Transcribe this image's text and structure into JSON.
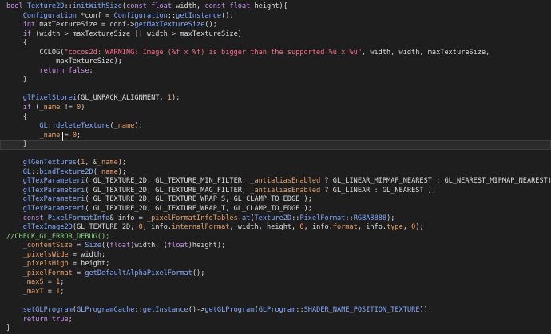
{
  "editor": {
    "lines": [
      {
        "tokens": [
          {
            "t": "bool ",
            "c": "kw"
          },
          {
            "t": "Texture2D",
            "c": "type"
          },
          {
            "t": "::",
            "c": "p"
          },
          {
            "t": "initWithSize",
            "c": "fn"
          },
          {
            "t": "(",
            "c": "p"
          },
          {
            "t": "const float ",
            "c": "kw"
          },
          {
            "t": "width, ",
            "c": "txt"
          },
          {
            "t": "const float ",
            "c": "kw"
          },
          {
            "t": "height){",
            "c": "txt"
          }
        ]
      },
      {
        "tokens": [
          {
            "t": "    ",
            "c": "txt"
          },
          {
            "t": "Configuration ",
            "c": "type"
          },
          {
            "t": "*conf = ",
            "c": "txt"
          },
          {
            "t": "Configuration",
            "c": "type"
          },
          {
            "t": "::",
            "c": "p"
          },
          {
            "t": "getInstance",
            "c": "fn"
          },
          {
            "t": "();",
            "c": "p"
          }
        ]
      },
      {
        "tokens": [
          {
            "t": "    ",
            "c": "txt"
          },
          {
            "t": "int ",
            "c": "kw"
          },
          {
            "t": "maxTextureSize = conf->",
            "c": "txt"
          },
          {
            "t": "getMaxTextureSize",
            "c": "fn"
          },
          {
            "t": "();",
            "c": "p"
          }
        ]
      },
      {
        "tokens": [
          {
            "t": "    ",
            "c": "txt"
          },
          {
            "t": "if ",
            "c": "kw"
          },
          {
            "t": "(width > maxTextureSize || width > maxTextureSize)",
            "c": "txt"
          }
        ]
      },
      {
        "tokens": [
          {
            "t": "    {",
            "c": "txt"
          }
        ]
      },
      {
        "tokens": [
          {
            "t": "        CCLOG(",
            "c": "txt"
          },
          {
            "t": "\"cocos2d: WARNING: Image (%f x %f) is bigger than the supported %u x %u\"",
            "c": "str"
          },
          {
            "t": ", width, width, maxTextureSize,",
            "c": "txt"
          }
        ]
      },
      {
        "tokens": [
          {
            "t": "            maxTextureSize);",
            "c": "txt"
          }
        ]
      },
      {
        "tokens": [
          {
            "t": "        ",
            "c": "txt"
          },
          {
            "t": "return false",
            "c": "kw"
          },
          {
            "t": ";",
            "c": "p"
          }
        ]
      },
      {
        "tokens": [
          {
            "t": "    }",
            "c": "txt"
          }
        ]
      },
      {
        "tokens": []
      },
      {
        "tokens": [
          {
            "t": "    ",
            "c": "txt"
          },
          {
            "t": "glPixelStorei",
            "c": "fn"
          },
          {
            "t": "(GL_UNPACK_ALIGNMENT, ",
            "c": "txt"
          },
          {
            "t": "1",
            "c": "num"
          },
          {
            "t": ");",
            "c": "p"
          }
        ]
      },
      {
        "tokens": [
          {
            "t": "    ",
            "c": "txt"
          },
          {
            "t": "if ",
            "c": "kw"
          },
          {
            "t": "(",
            "c": "p"
          },
          {
            "t": "_name",
            "c": "mem"
          },
          {
            "t": " != ",
            "c": "txt"
          },
          {
            "t": "0",
            "c": "num"
          },
          {
            "t": ")",
            "c": "p"
          }
        ]
      },
      {
        "tokens": [
          {
            "t": "    {",
            "c": "txt"
          }
        ]
      },
      {
        "tokens": [
          {
            "t": "        ",
            "c": "txt"
          },
          {
            "t": "GL",
            "c": "type"
          },
          {
            "t": "::",
            "c": "p"
          },
          {
            "t": "deleteTexture",
            "c": "fn"
          },
          {
            "t": "(",
            "c": "p"
          },
          {
            "t": "_name",
            "c": "mem"
          },
          {
            "t": ");",
            "c": "p"
          }
        ]
      },
      {
        "tokens": [
          {
            "t": "        ",
            "c": "txt"
          },
          {
            "t": "_name",
            "c": "mem"
          },
          {
            "t": " = ",
            "c": "txt"
          },
          {
            "t": "0",
            "c": "num"
          },
          {
            "t": ";",
            "c": "p"
          }
        ]
      },
      {
        "tokens": [
          {
            "t": "    }",
            "c": "txt"
          }
        ],
        "highlight": true
      },
      {
        "tokens": []
      },
      {
        "tokens": [
          {
            "t": "    ",
            "c": "txt"
          },
          {
            "t": "glGenTextures",
            "c": "fn"
          },
          {
            "t": "(",
            "c": "p"
          },
          {
            "t": "1",
            "c": "num"
          },
          {
            "t": ", &",
            "c": "txt"
          },
          {
            "t": "_name",
            "c": "mem"
          },
          {
            "t": ");",
            "c": "p"
          }
        ]
      },
      {
        "tokens": [
          {
            "t": "    ",
            "c": "txt"
          },
          {
            "t": "GL",
            "c": "type"
          },
          {
            "t": "::",
            "c": "p"
          },
          {
            "t": "bindTexture2D",
            "c": "fn"
          },
          {
            "t": "(",
            "c": "p"
          },
          {
            "t": "_name",
            "c": "mem"
          },
          {
            "t": ");",
            "c": "p"
          }
        ]
      },
      {
        "tokens": [
          {
            "t": "    ",
            "c": "txt"
          },
          {
            "t": "glTexParameteri",
            "c": "fn"
          },
          {
            "t": "( GL_TEXTURE_2D, GL_TEXTURE_MIN_FILTER, ",
            "c": "txt"
          },
          {
            "t": "_antialiasEnabled",
            "c": "mem"
          },
          {
            "t": " ? GL_LINEAR_MIPMAP_NEAREST : GL_NEAREST_MIPMAP_NEAREST);",
            "c": "txt"
          }
        ]
      },
      {
        "tokens": [
          {
            "t": "    ",
            "c": "txt"
          },
          {
            "t": "glTexParameteri",
            "c": "fn"
          },
          {
            "t": "( GL_TEXTURE_2D, GL_TEXTURE_MAG_FILTER, ",
            "c": "txt"
          },
          {
            "t": "_antialiasEnabled",
            "c": "mem"
          },
          {
            "t": " ? GL_LINEAR : GL_NEAREST );",
            "c": "txt"
          }
        ]
      },
      {
        "tokens": [
          {
            "t": "    ",
            "c": "txt"
          },
          {
            "t": "glTexParameteri",
            "c": "fn"
          },
          {
            "t": "( GL_TEXTURE_2D, GL_TEXTURE_WRAP_S, GL_CLAMP_TO_EDGE );",
            "c": "txt"
          }
        ]
      },
      {
        "tokens": [
          {
            "t": "    ",
            "c": "txt"
          },
          {
            "t": "glTexParameteri",
            "c": "fn"
          },
          {
            "t": "( GL_TEXTURE_2D, GL_TEXTURE_WRAP_T, GL_CLAMP_TO_EDGE );",
            "c": "txt"
          }
        ]
      },
      {
        "tokens": [
          {
            "t": "    ",
            "c": "txt"
          },
          {
            "t": "const ",
            "c": "kw"
          },
          {
            "t": "PixelFormatInfo",
            "c": "type"
          },
          {
            "t": "& info = ",
            "c": "txt"
          },
          {
            "t": "_pixelFormatInfoTables",
            "c": "mem"
          },
          {
            "t": ".",
            "c": "p"
          },
          {
            "t": "at",
            "c": "fn"
          },
          {
            "t": "(",
            "c": "p"
          },
          {
            "t": "Texture2D",
            "c": "type"
          },
          {
            "t": "::",
            "c": "p"
          },
          {
            "t": "PixelFormat",
            "c": "type"
          },
          {
            "t": "::",
            "c": "p"
          },
          {
            "t": "RGBA8888",
            "c": "type"
          },
          {
            "t": ");",
            "c": "p"
          }
        ]
      },
      {
        "tokens": [
          {
            "t": "    ",
            "c": "txt"
          },
          {
            "t": "glTexImage2D",
            "c": "fn"
          },
          {
            "t": "(GL_TEXTURE_2D, ",
            "c": "txt"
          },
          {
            "t": "0",
            "c": "num"
          },
          {
            "t": ", info.",
            "c": "txt"
          },
          {
            "t": "internalFormat",
            "c": "mem"
          },
          {
            "t": ", width, height, ",
            "c": "txt"
          },
          {
            "t": "0",
            "c": "num"
          },
          {
            "t": ", info.",
            "c": "txt"
          },
          {
            "t": "format",
            "c": "mem"
          },
          {
            "t": ", info.",
            "c": "txt"
          },
          {
            "t": "type",
            "c": "mem"
          },
          {
            "t": ", ",
            "c": "txt"
          },
          {
            "t": "0",
            "c": "num"
          },
          {
            "t": ");",
            "c": "p"
          }
        ]
      },
      {
        "tokens": [
          {
            "t": "//CHECK_GL_ERROR_DEBUG();",
            "c": "cmt"
          }
        ]
      },
      {
        "tokens": [
          {
            "t": "    ",
            "c": "txt"
          },
          {
            "t": "_contentSize",
            "c": "mem"
          },
          {
            "t": " = ",
            "c": "txt"
          },
          {
            "t": "Size",
            "c": "type"
          },
          {
            "t": "((",
            "c": "p"
          },
          {
            "t": "float",
            "c": "kw"
          },
          {
            "t": ")width, (",
            "c": "txt"
          },
          {
            "t": "float",
            "c": "kw"
          },
          {
            "t": ")height);",
            "c": "txt"
          }
        ]
      },
      {
        "tokens": [
          {
            "t": "    ",
            "c": "txt"
          },
          {
            "t": "_pixelsWide",
            "c": "mem"
          },
          {
            "t": " = width;",
            "c": "txt"
          }
        ]
      },
      {
        "tokens": [
          {
            "t": "    ",
            "c": "txt"
          },
          {
            "t": "_pixelsHigh",
            "c": "mem"
          },
          {
            "t": " = height;",
            "c": "txt"
          }
        ]
      },
      {
        "tokens": [
          {
            "t": "    ",
            "c": "txt"
          },
          {
            "t": "_pixelFormat",
            "c": "mem"
          },
          {
            "t": " = ",
            "c": "txt"
          },
          {
            "t": "getDefaultAlphaPixelFormat",
            "c": "fn"
          },
          {
            "t": "();",
            "c": "p"
          }
        ]
      },
      {
        "tokens": [
          {
            "t": "    ",
            "c": "txt"
          },
          {
            "t": "_maxS",
            "c": "mem"
          },
          {
            "t": " = ",
            "c": "txt"
          },
          {
            "t": "1",
            "c": "num"
          },
          {
            "t": ";",
            "c": "p"
          }
        ]
      },
      {
        "tokens": [
          {
            "t": "    ",
            "c": "txt"
          },
          {
            "t": "_maxT",
            "c": "mem"
          },
          {
            "t": " = ",
            "c": "txt"
          },
          {
            "t": "1",
            "c": "num"
          },
          {
            "t": ";",
            "c": "p"
          }
        ]
      },
      {
        "tokens": []
      },
      {
        "tokens": [
          {
            "t": "    ",
            "c": "txt"
          },
          {
            "t": "setGLProgram",
            "c": "fn"
          },
          {
            "t": "(",
            "c": "p"
          },
          {
            "t": "GLProgramCache",
            "c": "type"
          },
          {
            "t": "::",
            "c": "p"
          },
          {
            "t": "getInstance",
            "c": "fn"
          },
          {
            "t": "()->",
            "c": "p"
          },
          {
            "t": "getGLProgram",
            "c": "fn"
          },
          {
            "t": "(",
            "c": "p"
          },
          {
            "t": "GLProgram",
            "c": "type"
          },
          {
            "t": "::",
            "c": "p"
          },
          {
            "t": "SHADER_NAME_POSITION_TEXTURE",
            "c": "type"
          },
          {
            "t": "));",
            "c": "p"
          }
        ]
      },
      {
        "tokens": [
          {
            "t": "    ",
            "c": "txt"
          },
          {
            "t": "return true",
            "c": "kw"
          },
          {
            "t": ";",
            "c": "p"
          }
        ]
      },
      {
        "tokens": [
          {
            "t": "}",
            "c": "txt"
          }
        ]
      }
    ]
  },
  "colors": {
    "background": "#1e1e1e",
    "keyword": "#c792ea",
    "type": "#82aaff",
    "string": "#ff6b8a",
    "number": "#ff9e64",
    "member": "#e8a06a",
    "comment": "#89d185",
    "text": "#dcdcdc"
  }
}
